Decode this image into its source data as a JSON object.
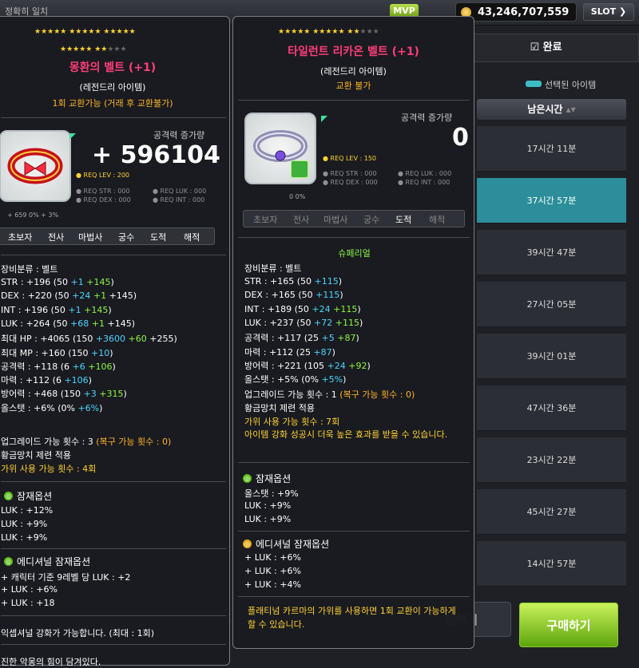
{
  "topbar": {
    "exact_match": "정확히 일치",
    "mvp": "MVP",
    "meso": "43,246,707,559",
    "slot": "SLOT"
  },
  "market": {
    "done_tab": "완료",
    "legend": "선택된 아이템",
    "remaining_header": "남은시간",
    "rows": [
      "17시간 11분",
      "37시간 57분",
      "39시간 47분",
      "27시간 05분",
      "39시간 01분",
      "47시간 36분",
      "23시간 22분",
      "45시간 27분",
      "14시간 57분"
    ],
    "selected_row": 1,
    "watch_button": "찜하기",
    "buy_button": "구매하기",
    "accent_color": "#2b8e9a"
  },
  "tooltip_left": {
    "stars_row1": "★★★★★ ★★★★★ ★★★★★",
    "stars_row2_on": "★★★★★ ★★",
    "stars_row2_off": "★★★",
    "name": "몽환의 벨트 (+1)",
    "type": "(레전드리 아이템)",
    "trade": "1회 교환가능 (거래 후 교환불가)",
    "atk_label": "공격력 증가량",
    "atk_value": "+ 596104",
    "req_lev": "● REQ LEV : 200",
    "req_str": "● REQ STR : 000",
    "req_luk": "● REQ LUK : 000",
    "req_dex": "● REQ DEX : 000",
    "req_int": "● REQ INT : 000",
    "mini_row": "+ 659   0%   + 3%",
    "jobs": [
      "초보자",
      "전사",
      "마법사",
      "궁수",
      "도적",
      "해적"
    ],
    "category": "장비분류 : 벨트",
    "stats": [
      {
        "k": "STR : +196 (50",
        "a": " +1",
        "b": " +145",
        "c": ")"
      },
      {
        "k": "DEX : +220 (50",
        "a": " +24",
        "b": " +1",
        "c": " +145)"
      },
      {
        "k": "INT : +196 (50",
        "a": " +1",
        "b": " +145",
        "c": ")"
      },
      {
        "k": "LUK : +264 (50",
        "a": " +68",
        "b": " +1",
        "c": " +145)"
      },
      {
        "k": "최대 HP : +4065 (150",
        "a": " +3600",
        "b": " +60",
        "c": " +255)"
      },
      {
        "k": "최대 MP : +160 (150",
        "a": " +10",
        "b": "",
        "c": ")"
      },
      {
        "k": "공격력 : +118 (6",
        "a": " +6",
        "b": " +106",
        "c": ")"
      },
      {
        "k": "마력 : +112 (6",
        "a": " +106",
        "b": "",
        "c": ")"
      },
      {
        "k": "방어력 : +468 (150",
        "a": " +3",
        "b": " +315",
        "c": ")"
      },
      {
        "k": "올스탯 : +6% (0%",
        "a": " +6%",
        "b": "",
        "c": ")"
      }
    ],
    "upgrade": "업그레이드 가능 횟수 : 3",
    "upgrade_recover": " (복구 가능 횟수 : 0)",
    "golden_hammer": "황금망치 제련 적용",
    "scissors": "가위 사용 가능 횟수 : 4회",
    "potential_title": "잠재옵션",
    "potential": [
      "LUK : +12%",
      "LUK : +9%",
      "LUK : +9%"
    ],
    "add_potential_title": "에디셔널 잠재옵션",
    "add_potential": [
      "+ 캐릭터 기준 9레벨 당 LUK : +2",
      "+ LUK : +6%",
      "+ LUK : +18"
    ],
    "exceptional": "익셉셔널 강화가 가능합니다. (최대 : 1회)",
    "evil": "진한 악몽의 힘이 담겨있다."
  },
  "tooltip_right": {
    "stars_row1_on": "★★★★★ ★★★★★ ★★",
    "stars_row1_off": "★★★",
    "name": "타일런트 리카온 벨트 (+1)",
    "type": "(레전드리 아이템)",
    "trade": "교환 불가",
    "atk_label": "공격력 증가량",
    "atk_value": "0",
    "req_lev": "● REQ LEV : 150",
    "req_str": "● REQ STR : 000",
    "req_luk": "● REQ LUK : 000",
    "req_dex": "● REQ DEX : 000",
    "req_int": "● REQ INT : 000",
    "mini_row": "0   0%",
    "jobs": [
      "초보자",
      "전사",
      "마법사",
      "궁수",
      "도적",
      "해적"
    ],
    "superior": "슈페리얼",
    "category": "장비분류 : 벨트",
    "stats": [
      {
        "k": "STR : +165 (50",
        "a": " +115",
        "b": "",
        "c": ")"
      },
      {
        "k": "DEX : +165 (50",
        "a": " +115",
        "b": "",
        "c": ")"
      },
      {
        "k": "INT : +189 (50",
        "a": " +24",
        "b": " +115",
        "c": ")"
      },
      {
        "k": "LUK : +237 (50",
        "a": " +72",
        "b": " +115",
        "c": ")"
      },
      {
        "k": "공격력 : +117 (25",
        "a": " +5",
        "b": " +87",
        "c": ")"
      },
      {
        "k": "마력 : +112 (25",
        "a": " +87",
        "b": "",
        "c": ")"
      },
      {
        "k": "방어력 : +221 (105",
        "a": " +24",
        "b": " +92",
        "c": ")"
      },
      {
        "k": "올스탯 : +5% (0%",
        "a": " +5%",
        "b": "",
        "c": ")"
      }
    ],
    "upgrade": "업그레이드 가능 횟수 : 1",
    "upgrade_recover": " (복구 가능 횟수 : 0)",
    "golden_hammer": "황금망치 제련 적용",
    "scissors": "가위 사용 가능 횟수 : 7회",
    "enhance_note": "아이템 강화 성공시 더욱 높은 효과를 받을 수 있습니다.",
    "potential_title": "잠재옵션",
    "potential": [
      "올스탯 : +9%",
      "LUK : +9%",
      "LUK : +9%"
    ],
    "add_potential_title": "에디셔널 잠재옵션",
    "add_potential": [
      "+ LUK : +6%",
      "+ LUK : +6%",
      "+ LUK : +4%"
    ],
    "karma_note": "플래티넘 카르마의 가위를 사용하면 1회 교환이 가능하게 할 수 있습니다."
  }
}
